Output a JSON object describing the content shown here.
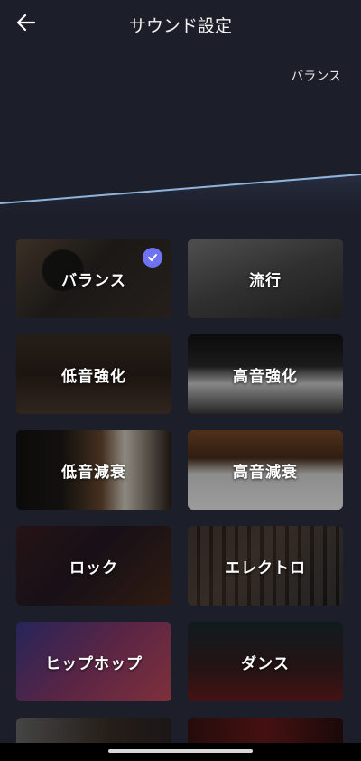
{
  "header": {
    "title": "サウンド設定",
    "back_icon": "arrow-left-icon"
  },
  "current_preset": "バランス",
  "presets": [
    {
      "label": "バランス",
      "selected": true
    },
    {
      "label": "流行",
      "selected": false
    },
    {
      "label": "低音強化",
      "selected": false
    },
    {
      "label": "高音強化",
      "selected": false
    },
    {
      "label": "低音減衰",
      "selected": false
    },
    {
      "label": "高音減衰",
      "selected": false
    },
    {
      "label": "ロック",
      "selected": false
    },
    {
      "label": "エレクトロ",
      "selected": false
    },
    {
      "label": "ヒップホップ",
      "selected": false
    },
    {
      "label": "ダンス",
      "selected": false
    }
  ],
  "colors": {
    "background": "#1c1e29",
    "accent": "#6f72f2",
    "eq_line": "#8fb4dc"
  }
}
